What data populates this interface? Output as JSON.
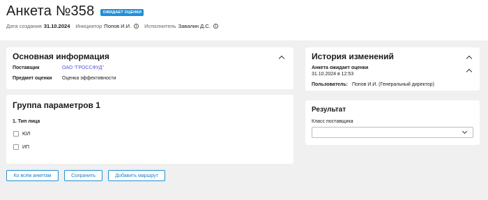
{
  "header": {
    "title": "Анкета №358",
    "status_badge": "ОЖИДАЕТ ОЦЕНКИ",
    "created_label": "Дата создания",
    "created_value": "31.10.2024",
    "initiator_label": "Инициатор",
    "initiator_value": "Попов И.И.",
    "executor_label": "Исполнитель",
    "executor_value": "Завалин Д.С."
  },
  "main_info": {
    "title": "Основная информация",
    "supplier_label": "Поставщик",
    "supplier_value": "ОАО \"ГРОССФУД\"",
    "subject_label": "Предмет оценки",
    "subject_value": "Оценка эффективности"
  },
  "param_group": {
    "title": "Группа параметров 1",
    "question": "1. Тип лица",
    "options": [
      "ЮЛ",
      "ИП"
    ]
  },
  "history": {
    "title": "История изменений",
    "entry_title": "Анкета ожидает оценки",
    "entry_datetime": "31.10.2024 в 12:53",
    "user_label": "Пользователь:",
    "user_value": "Попов И.И. (Генеральный директор)"
  },
  "result": {
    "title": "Результат",
    "class_label": "Класс поставщика",
    "class_value": ""
  },
  "actions": {
    "all_forms": "Ко всем анкетам",
    "save": "Сохранить",
    "add_route": "Добавить маршрут"
  }
}
